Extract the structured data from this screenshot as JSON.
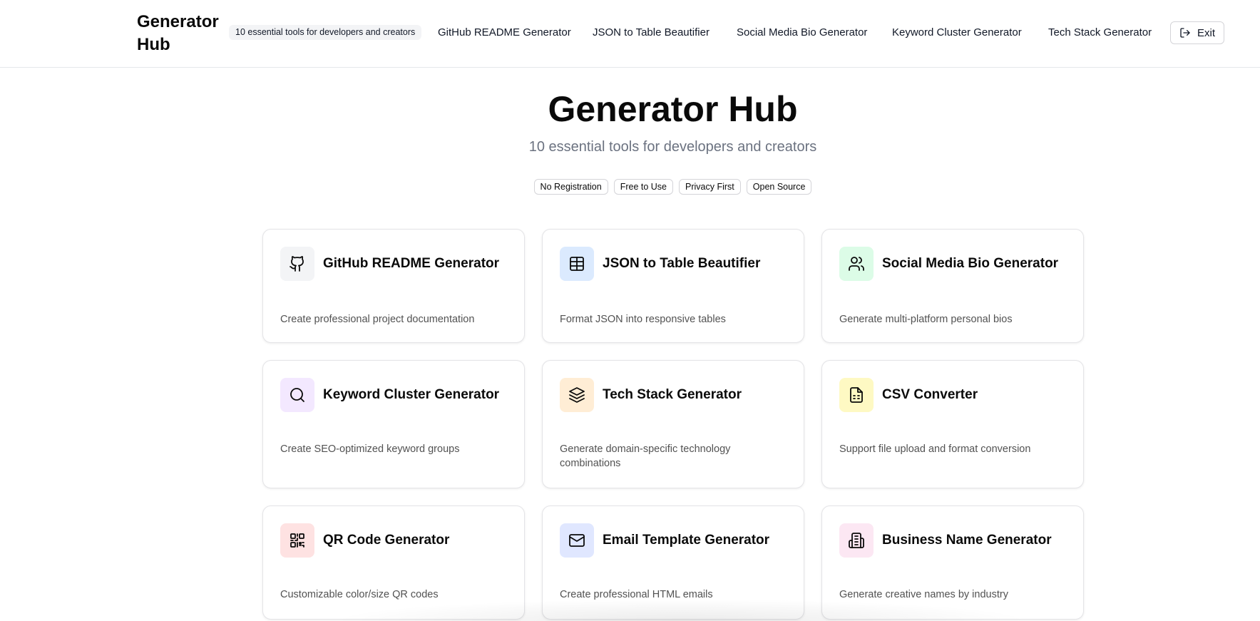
{
  "header": {
    "brand": "Generator Hub",
    "tagline": "10 essential tools for developers and creators",
    "nav": [
      {
        "label": "GitHub README Generator"
      },
      {
        "label": "JSON to Table Beautifier"
      },
      {
        "label": "Social Media Bio Generator"
      },
      {
        "label": "Keyword Cluster Generator"
      },
      {
        "label": "Tech Stack Generator"
      }
    ],
    "exit_label": "Exit"
  },
  "hero": {
    "title": "Generator Hub",
    "subtitle": "10 essential tools for developers and creators",
    "badges": [
      "No Registration",
      "Free to Use",
      "Privacy First",
      "Open Source"
    ]
  },
  "tools": [
    {
      "title": "GitHub README Generator",
      "desc": "Create professional project documentation",
      "icon": "github-icon",
      "icon_bg": "#f3f4f6"
    },
    {
      "title": "JSON to Table Beautifier",
      "desc": "Format JSON into responsive tables",
      "icon": "table-icon",
      "icon_bg": "#dbeafe"
    },
    {
      "title": "Social Media Bio Generator",
      "desc": "Generate multi-platform personal bios",
      "icon": "users-icon",
      "icon_bg": "#dcfce7"
    },
    {
      "title": "Keyword Cluster Generator",
      "desc": "Create SEO-optimized keyword groups",
      "icon": "search-icon",
      "icon_bg": "#f3e8ff"
    },
    {
      "title": "Tech Stack Generator",
      "desc": "Generate domain-specific technology combinations",
      "icon": "layers-icon",
      "icon_bg": "#ffedd5"
    },
    {
      "title": "CSV Converter",
      "desc": "Support file upload and format conversion",
      "icon": "file-spreadsheet-icon",
      "icon_bg": "#fef9c3"
    },
    {
      "title": "QR Code Generator",
      "desc": "Customizable color/size QR codes",
      "icon": "qr-code-icon",
      "icon_bg": "#fee2e2"
    },
    {
      "title": "Email Template Generator",
      "desc": "Create professional HTML emails",
      "icon": "mail-icon",
      "icon_bg": "#e0e7ff"
    },
    {
      "title": "Business Name Generator",
      "desc": "Generate creative names by industry",
      "icon": "building-icon",
      "icon_bg": "#fce7f3"
    }
  ]
}
